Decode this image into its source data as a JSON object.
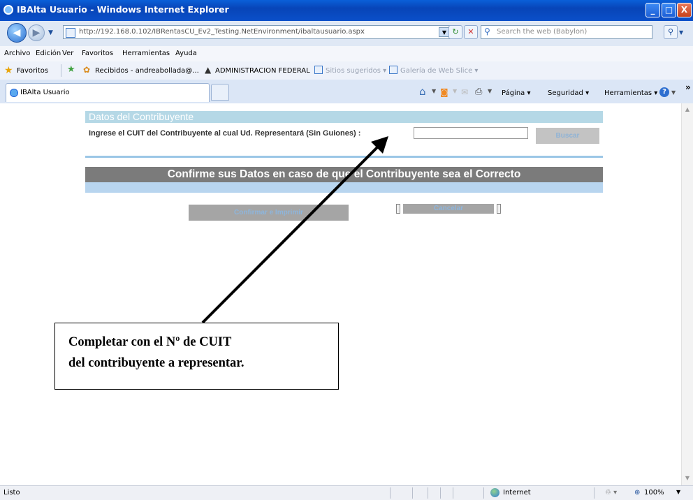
{
  "window": {
    "title": "IBAlta Usuario - Windows Internet Explorer",
    "minimize": "_",
    "maximize": "□",
    "close": "X"
  },
  "address_bar": {
    "url": "http://192.168.0.102/IBRentasCU_Ev2_Testing.NetEnvironment/ibaltausuario.aspx",
    "search_placeholder": "Search the web (Babylon)"
  },
  "menu": [
    "Archivo",
    "Edición",
    "Ver",
    "Favoritos",
    "Herramientas",
    "Ayuda"
  ],
  "favorites_bar": {
    "favorites_label": "Favoritos",
    "items": [
      "Recibidos - andreabollada@...",
      "ADMINISTRACION FEDERAL",
      "Sitios sugeridos ▾",
      "Galería de Web Slice ▾"
    ]
  },
  "tabs": {
    "active": "IBAlta Usuario"
  },
  "command_bar": {
    "pagina": "Página ▾",
    "seguridad": "Seguridad ▾",
    "herramientas": "Herramientas ▾",
    "more": "»"
  },
  "page": {
    "section_title": "Datos del Contribuyente",
    "cuit_label": "Ingrese el CUIT del Contribuyente al cual Ud. Representará (Sin Guiones) :",
    "cuit_value": "",
    "buscar": "Buscar",
    "confirm_header": "Confirme sus Datos en caso de que el Contribuyente sea el Correcto",
    "confirmar_imprimir": "Confirmar e Imprimir",
    "cancelar": "Cancelar"
  },
  "callout": {
    "line1": "Completar con el Nº de CUIT",
    "line2": "del contribuyente a representar."
  },
  "status_bar": {
    "status": "Listo",
    "zone": "Internet",
    "zoom": "100%"
  }
}
